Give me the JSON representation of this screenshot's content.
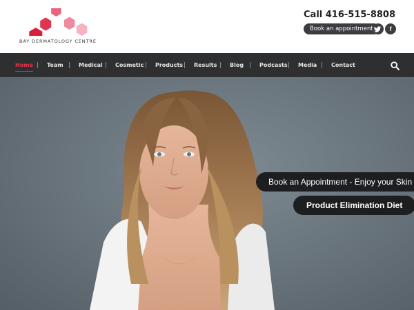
{
  "brand": {
    "name": "BAY DERMATOLOGY CENTRE",
    "colors": {
      "hex1": "#d81f3c",
      "hex2": "#e0354f",
      "hex3": "#e8647a",
      "hex4": "#f08aa0",
      "hex5": "#f5b3c1"
    }
  },
  "header": {
    "phone": "Call 416-515-8808",
    "book_label": "Book an appointment",
    "social": [
      {
        "name": "twitter-icon",
        "glyph": "t"
      },
      {
        "name": "facebook-icon",
        "glyph": "f"
      }
    ]
  },
  "nav": {
    "items": [
      {
        "label": "Home",
        "active": true
      },
      {
        "label": "Team"
      },
      {
        "label": "Medical"
      },
      {
        "label": "Cosmetic"
      },
      {
        "label": "Products"
      },
      {
        "label": "Results"
      },
      {
        "label": "Blog"
      },
      {
        "label": "Podcasts"
      },
      {
        "label": "Media"
      },
      {
        "label": "Contact"
      }
    ],
    "search_icon": "search-icon",
    "accent": "#e0354f",
    "background": "#2e2f31"
  },
  "hero": {
    "cta_primary": "Book an Appointment - Enjoy your Skin",
    "cta_secondary": "Product Elimination Diet"
  }
}
